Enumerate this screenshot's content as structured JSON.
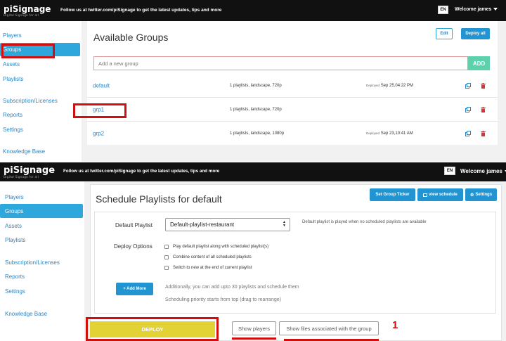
{
  "top": {
    "logo": "piSignage",
    "logo_sub": "Digital Signage for all",
    "follow": "Follow us at twitter.com/piSignage to get the latest updates, tips and more",
    "lang": "EN",
    "welcome": "Welcome james"
  },
  "sidebar_top": {
    "items": [
      "Players",
      "Groups",
      "Assets",
      "Playlists",
      "Subscription/Licenses",
      "Reports",
      "Settings",
      "Knowledge Base"
    ]
  },
  "groups": {
    "title": "Available Groups",
    "edit_label": "Edit",
    "deploy_all_label": "Deploy all",
    "add_placeholder": "Add a new group",
    "add_label": "ADD",
    "rows": [
      {
        "name": "default",
        "info": "1 playlists, landscape, 720p",
        "deployed_label": "Deployed",
        "deployed": "Sep 25,04:22 PM"
      },
      {
        "name": "grp1",
        "info": "1 playlists, landscape, 720p",
        "deployed_label": "",
        "deployed": ""
      },
      {
        "name": "grp2",
        "info": "1 playlists, landscape, 1080p",
        "deployed_label": "Deployed",
        "deployed": "Sep 23,10:41 AM"
      }
    ]
  },
  "top2": {
    "logo": "piSignage",
    "logo_sub": "Digital Signage for all",
    "follow": "Follow us at twitter.com/piSignage to get the latest updates, tips and more",
    "lang": "EN",
    "welcome": "Welcome james"
  },
  "sidebar_bottom": {
    "items": [
      "Players",
      "Groups",
      "Assets",
      "Playlists",
      "Subscription/Licenses",
      "Reports",
      "Settings",
      "Knowledge Base"
    ]
  },
  "schedule": {
    "title": "Schedule Playlists for default",
    "set_ticker_label": "Set Group Ticker",
    "view_schedule_label": "view schedule",
    "settings_label": "Settings",
    "default_playlist_label": "Default Playlist",
    "default_playlist_value": "Default-playlist-restaurant",
    "default_playlist_note": "Default playlist is played when no scheduled playlists are available",
    "deploy_options_label": "Deploy Options",
    "options": [
      "Play default playlist along with scheduled playlist(s)",
      "Combine content of all scheduled playlists",
      "Switch to new at the end of current playlist"
    ],
    "add_more_label": "+ Add More",
    "add_more_note1": "Additionally, you can add upto 30 playlists and schedule them",
    "add_more_note2": "Scheduling priority starts from top (drag to rearrange)",
    "deploy_label": "DEPLOY",
    "show_players_label": "Show players",
    "show_files_label": "Show files associated with the group",
    "annotation": "1"
  },
  "colors": {
    "accent": "#2ea7dd",
    "link": "#2a86c5",
    "add_button": "#5cd1ab",
    "deploy_button": "#e3d236",
    "highlight": "#d10f0f",
    "topbar": "#111111"
  }
}
